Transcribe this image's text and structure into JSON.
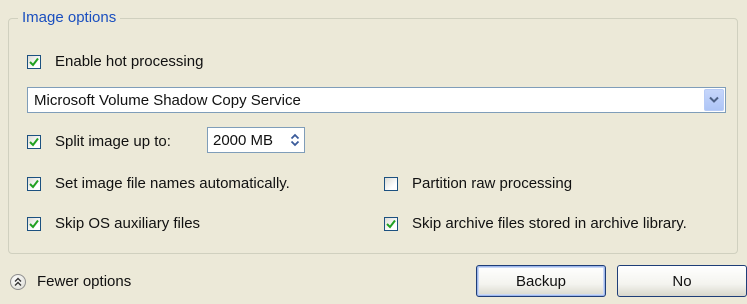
{
  "group": {
    "title": "Image options"
  },
  "options": {
    "enable_hot_processing": {
      "label": "Enable hot processing",
      "checked": true
    },
    "split_image": {
      "label": "Split image up to:",
      "checked": true
    },
    "auto_names": {
      "label": "Set image file names automatically.",
      "checked": true
    },
    "partition_raw": {
      "label": "Partition raw processing",
      "checked": false
    },
    "skip_os_aux": {
      "label": "Skip OS auxiliary files",
      "checked": true
    },
    "skip_archive": {
      "label": "Skip archive files stored in archive library.",
      "checked": true
    }
  },
  "snapshot_provider": {
    "selected": "Microsoft Volume Shadow Copy Service"
  },
  "split_size": {
    "value": "2000 MB"
  },
  "footer": {
    "fewer_options_label": "Fewer options",
    "backup_label": "Backup",
    "no_label": "No"
  },
  "colors": {
    "group_title": "#1a4fbf",
    "check_mark": "#21a121",
    "background": "#ece9d8"
  },
  "icons": {
    "checkbox_checked": "check-icon",
    "combo_arrow": "chevron-down-icon",
    "spinner": "spin-updown-icon",
    "collapse": "double-chevron-up-icon"
  }
}
